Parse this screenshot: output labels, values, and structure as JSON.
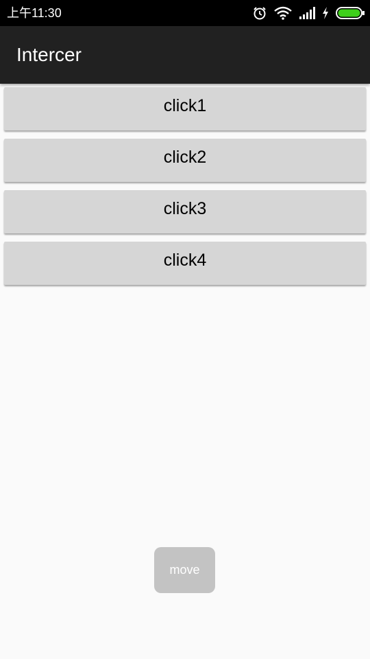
{
  "status_bar": {
    "time": "上午11:30",
    "icons": [
      "alarm-icon",
      "wifi-icon",
      "signal-icon",
      "charging-icon",
      "battery-icon"
    ],
    "battery_color": "#3ecf1a"
  },
  "app_bar": {
    "title": "Intercer",
    "background": "#212121"
  },
  "buttons": [
    {
      "label": "click1"
    },
    {
      "label": "click2"
    },
    {
      "label": "click3"
    },
    {
      "label": "click4"
    }
  ],
  "floating": {
    "move_label": "move"
  }
}
